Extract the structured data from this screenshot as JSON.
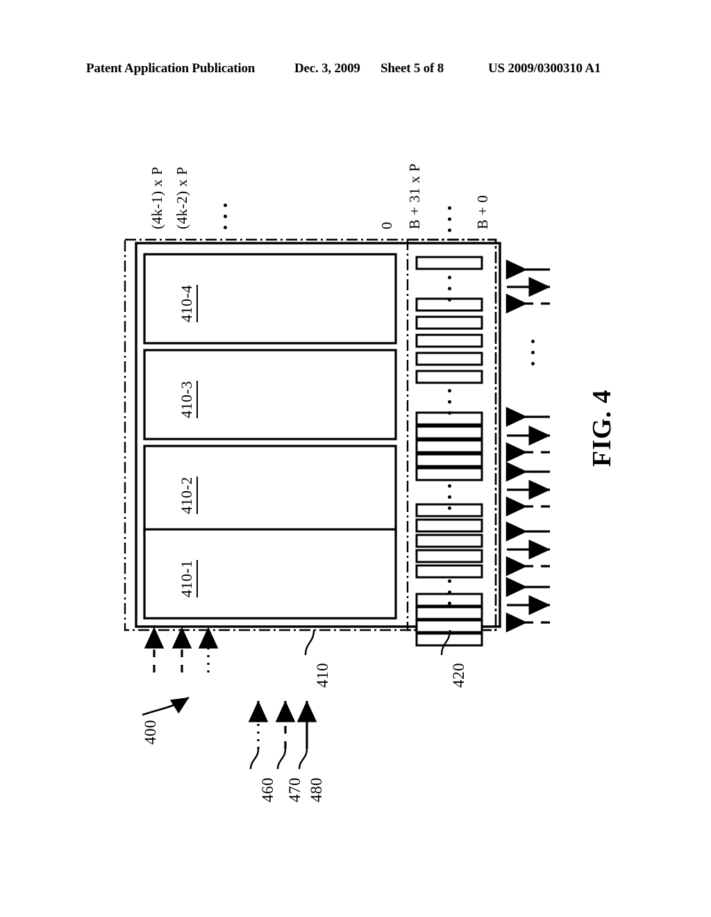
{
  "header": {
    "publication": "Patent Application Publication",
    "date": "Dec. 3, 2009",
    "sheet": "Sheet 5 of 8",
    "number": "US 2009/0300310 A1"
  },
  "figure": {
    "caption": "FIG. 4",
    "system_ref": "400",
    "memory_array_ref": "410",
    "bank_region_ref": "420",
    "top_labels": {
      "addr_high_1": "(4k-1) x P",
      "addr_high_2": "(4k-2) x P",
      "ellipsis": "⋮",
      "addr_zero": "0",
      "bank_high": "B + 31 x P",
      "bank_zero": "B + 0"
    },
    "blocks": [
      {
        "label": "410-4"
      },
      {
        "label": "410-3"
      },
      {
        "label": "410-2"
      },
      {
        "label": "410-1"
      }
    ],
    "legend": [
      {
        "ref": "460",
        "style": "dotted"
      },
      {
        "ref": "470",
        "style": "dashed"
      },
      {
        "ref": "480",
        "style": "solid"
      }
    ],
    "arrow_groups": [
      {
        "arrows": [
          "left-solid",
          "right-solid",
          "left-dashed"
        ]
      },
      {
        "arrows": [
          "left-solid",
          "right-solid",
          "left-dashed"
        ]
      },
      {
        "arrows": [
          "left-solid",
          "right-solid",
          "left-dashed"
        ]
      },
      {
        "arrows": [
          "left-solid",
          "right-solid",
          "left-dashed"
        ]
      },
      {
        "arrows": [
          "left-solid",
          "right-solid",
          "left-dashed"
        ]
      }
    ],
    "input_arrows": [
      {
        "style": "dashed"
      },
      {
        "style": "dashed"
      },
      {
        "style": "dotted"
      }
    ],
    "colors": {
      "ink": "#000000",
      "paper": "#ffffff"
    }
  }
}
